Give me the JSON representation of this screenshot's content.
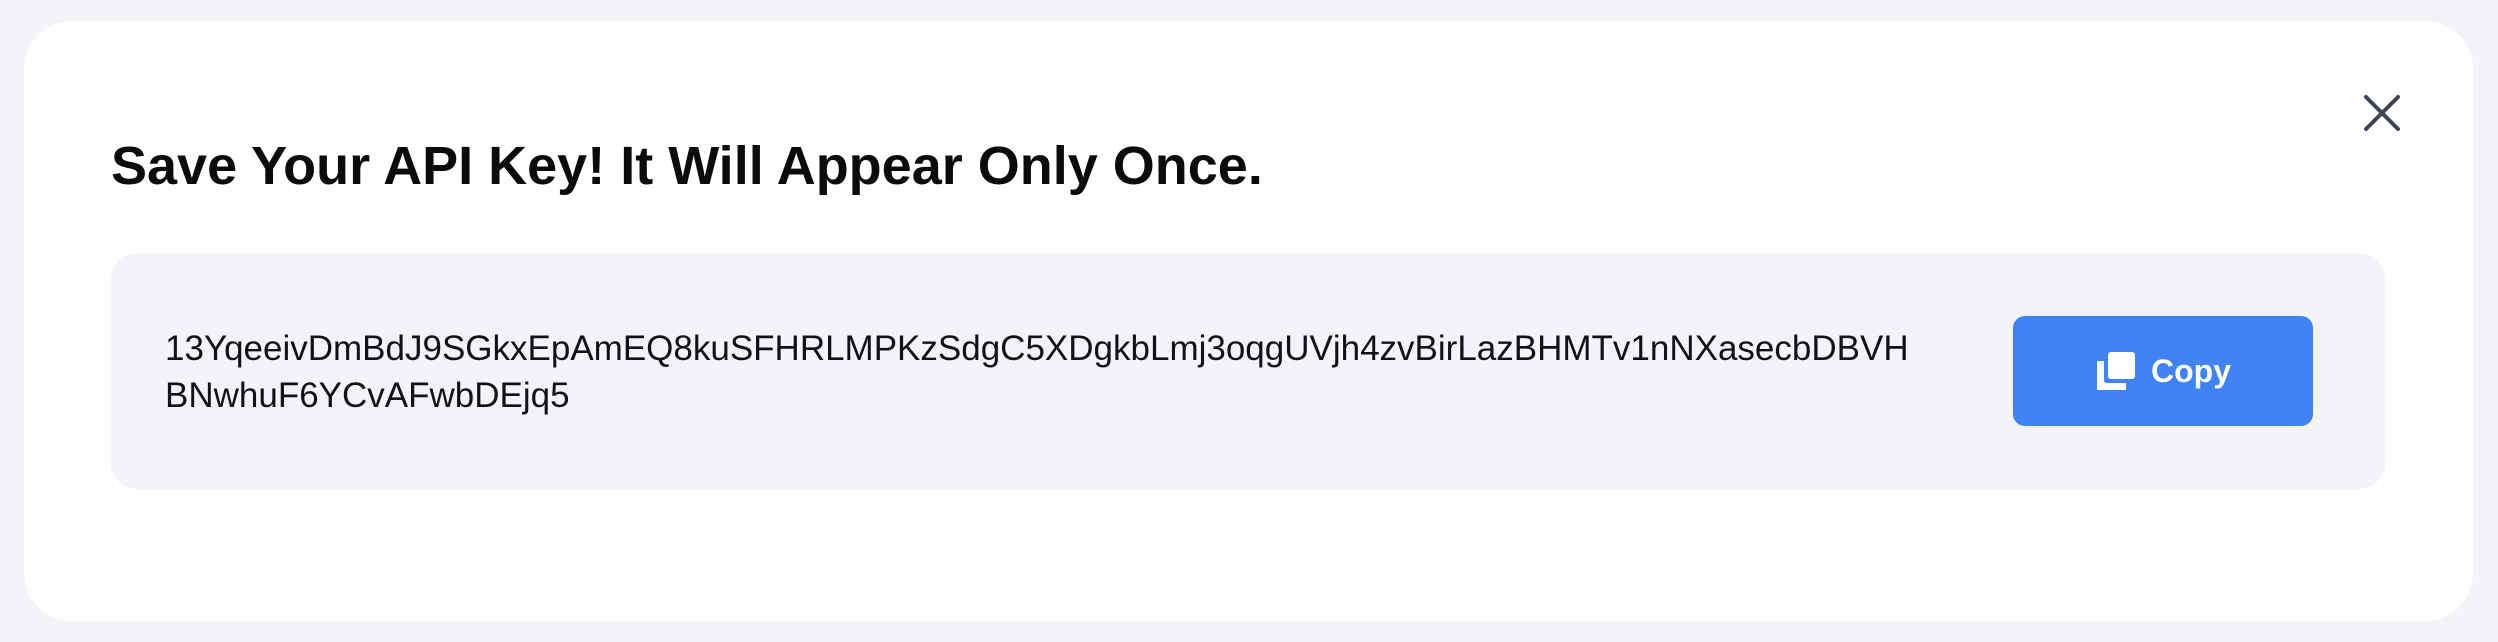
{
  "dialog": {
    "title": "Save Your API Key! It Will Appear Only Once.",
    "close_icon": "close-icon",
    "api_key": {
      "line1": "13YqeeivDmBdJ9SGkxEpAmEQ8kuSFHRLMPKzSdgC5XDgkbLmj3oqgUVjh4zvBirLazBHMTv1nNXasecbDBVH",
      "line2": "BNwhuF6YCvAFwbDEjq5"
    },
    "copy_button": {
      "label": "Copy",
      "icon": "copy-icon",
      "color": "#3f83f5"
    }
  },
  "colors": {
    "page_background": "#f3f4f8",
    "modal_background": "#ffffff",
    "key_box_background": "#f3f4f8",
    "title_text": "#0b0b0c"
  }
}
